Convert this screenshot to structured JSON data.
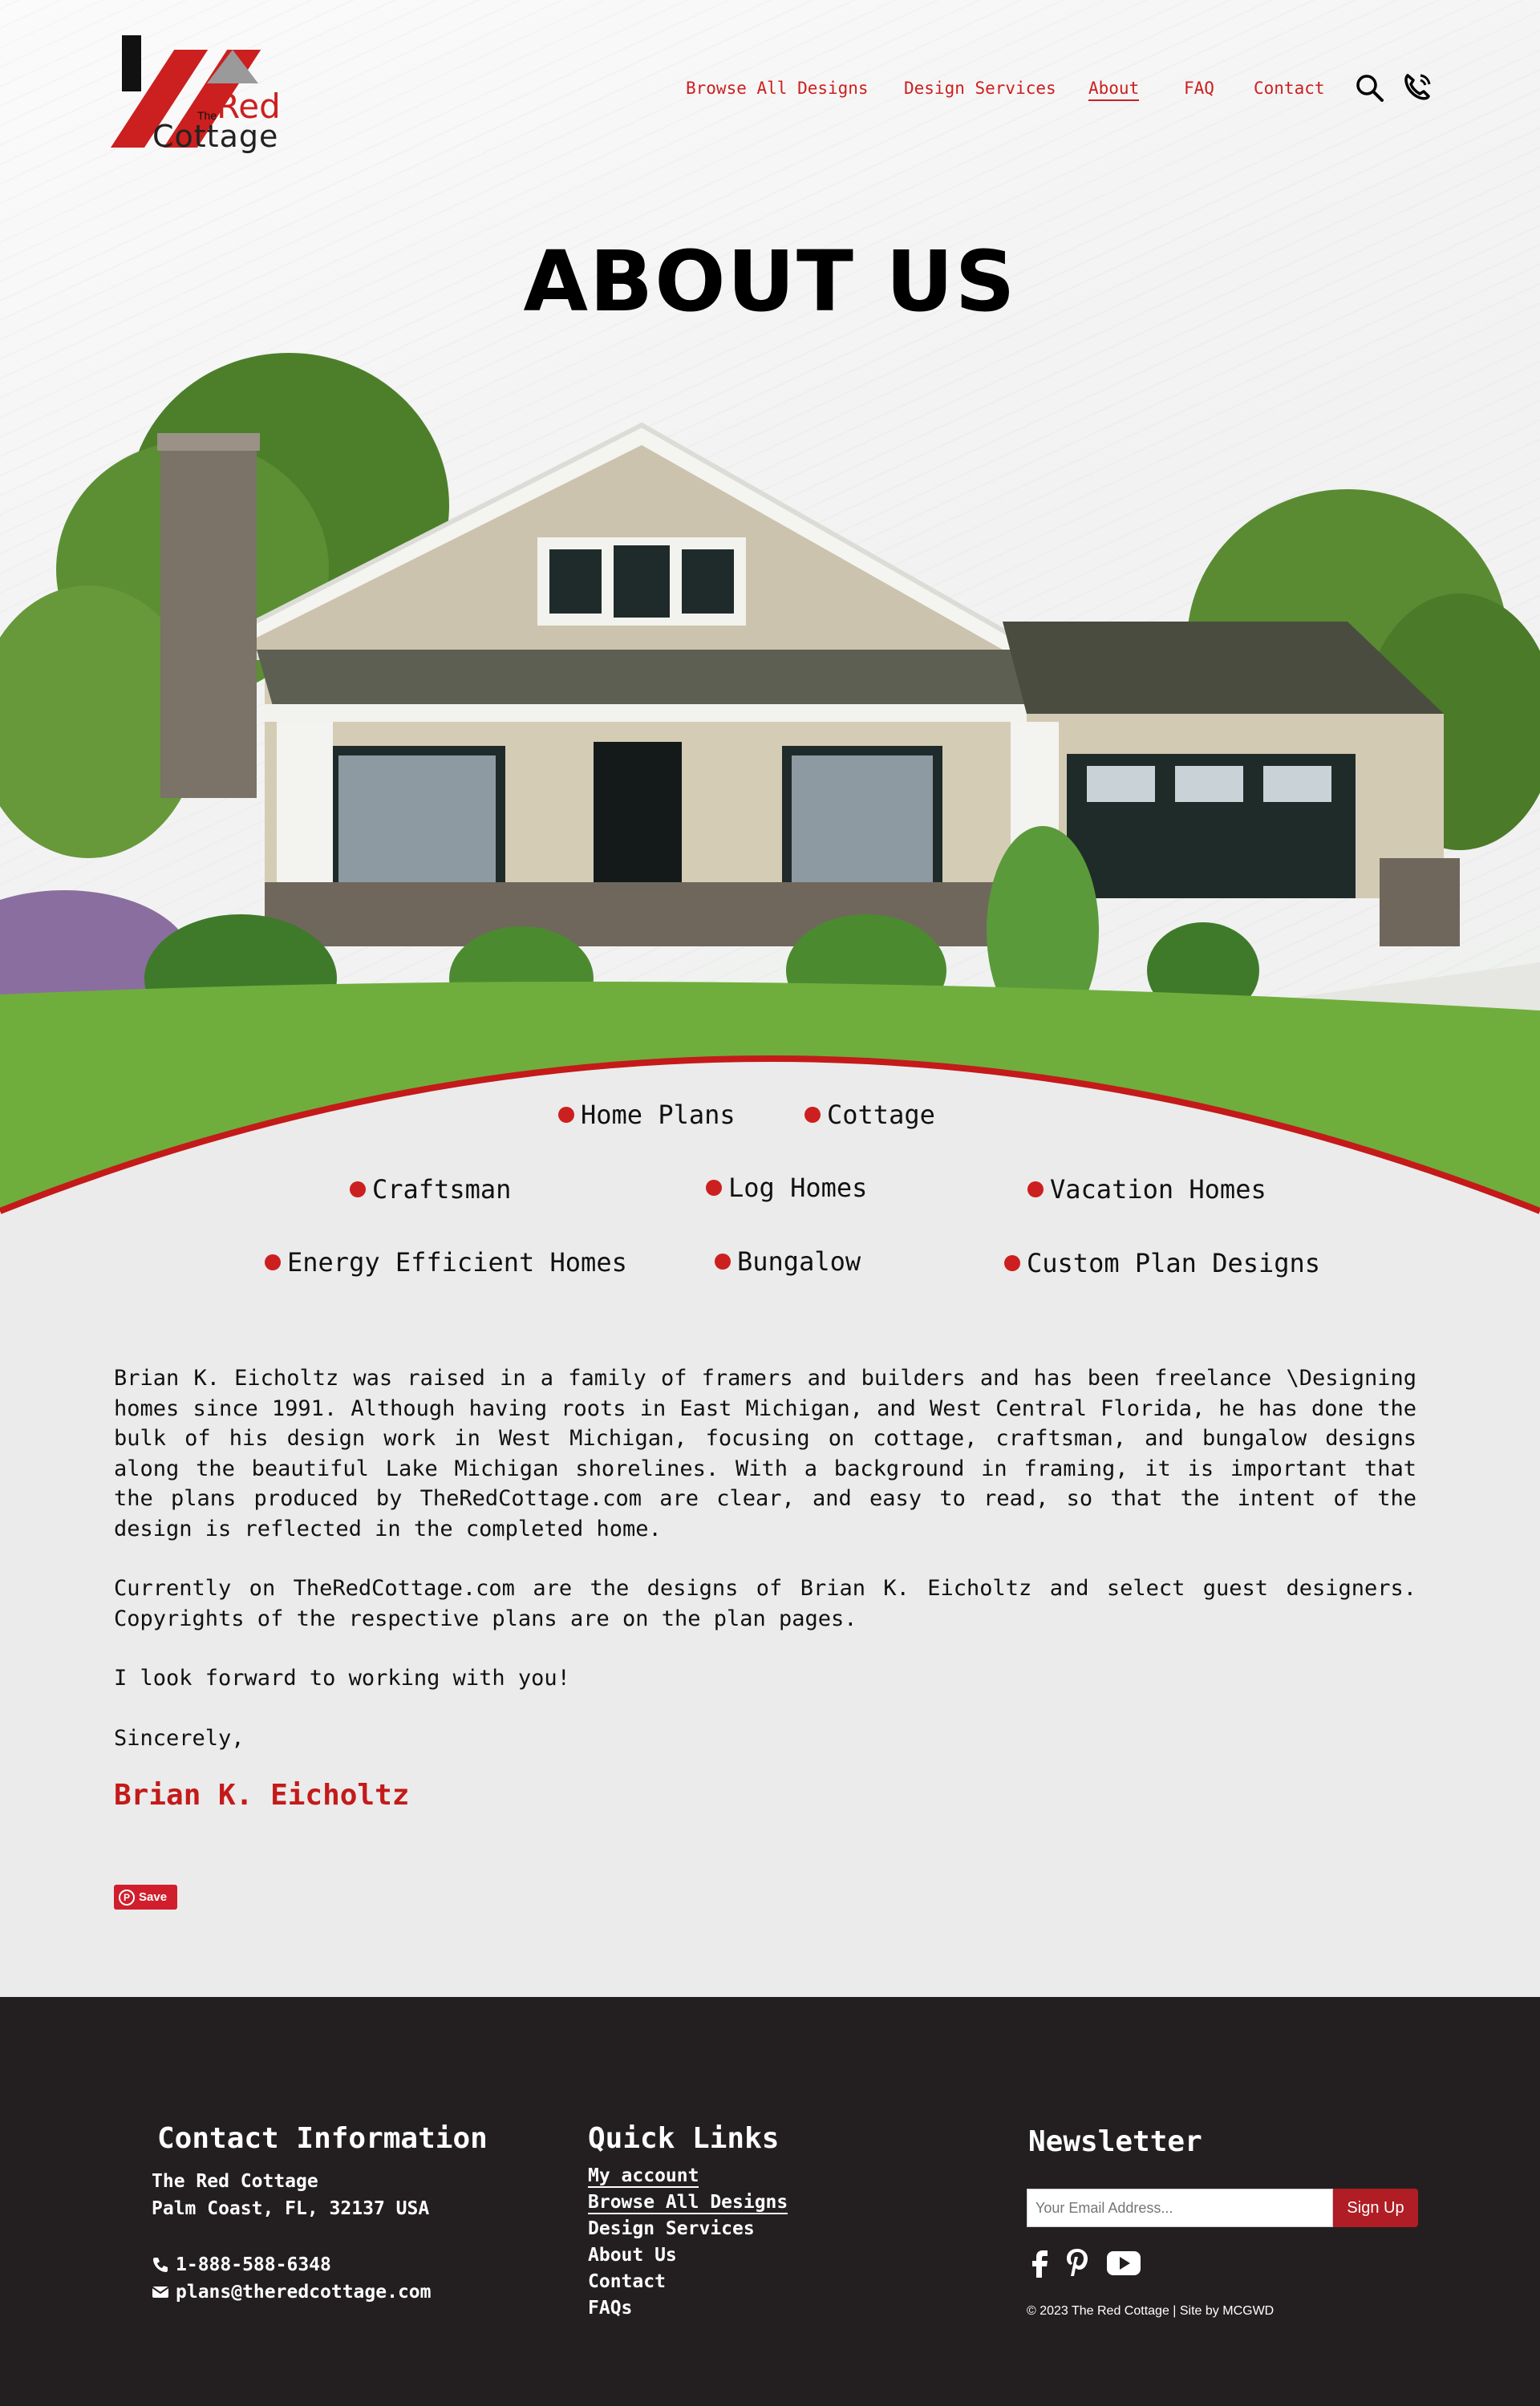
{
  "brand": {
    "the": "The",
    "red": "Red",
    "cottage": "Cottage"
  },
  "nav": {
    "items": [
      "Browse All Designs",
      "Design Services",
      "About",
      "FAQ",
      "Contact"
    ],
    "active": "About"
  },
  "hero": {
    "title": "ABOUT US"
  },
  "categories": [
    "Home Plans",
    "Cottage",
    "Craftsman",
    "Log Homes",
    "Vacation Homes",
    "Energy Efficient Homes",
    "Bungalow",
    "Custom Plan Designs"
  ],
  "about": {
    "p1": "Brian K. Eicholtz was raised in a family of framers and builders and has been freelance \\Designing homes since 1991. Although having roots in East Michigan, and West Central Florida, he has done the bulk of his design work in West Michigan, focusing on cottage, craftsman, and bungalow designs along the beautiful Lake Michigan shorelines. With a background in framing, it is important that the plans produced by TheRedCottage.com are clear, and easy to read, so that the intent of the design is reflected in the completed home.",
    "p2": "Currently on TheRedCottage.com are the designs of Brian K. Eicholtz and select guest designers. Copyrights of the respective plans are on the plan pages.",
    "p3": "I look forward to working with you!",
    "closing": "Sincerely,",
    "signature": "Brian K. Eicholtz",
    "pin_label": "Save"
  },
  "footer": {
    "contact": {
      "heading": "Contact Information",
      "name": "The Red Cottage",
      "address": "Palm Coast, FL, 32137 USA",
      "phone": "1-888-588-6348",
      "email": "plans@theredcottage.com"
    },
    "quick_links": {
      "heading": "Quick Links",
      "items": [
        "My account",
        "Browse All Designs",
        "Design Services",
        "About Us",
        "Contact",
        "FAQs"
      ]
    },
    "newsletter": {
      "heading": "Newsletter",
      "placeholder": "Your Email Address...",
      "button": "Sign Up"
    },
    "social_icons": [
      "facebook-icon",
      "pinterest-icon",
      "youtube-icon"
    ],
    "copyright": "© 2023 The Red Cottage  |  Site by MCGWD"
  },
  "colors": {
    "accent": "#cc1f1f",
    "footer_bg": "#231f20",
    "page_bg": "#ebebeb"
  }
}
